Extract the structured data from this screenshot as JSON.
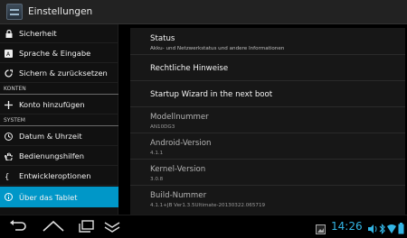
{
  "actionbar": {
    "title": "Einstellungen",
    "icon": "settings-app-icon"
  },
  "sidebar": {
    "items": [
      {
        "label": "Sicherheit",
        "icon": "lock-icon"
      },
      {
        "label": "Sprache & Eingabe",
        "icon": "language-icon"
      },
      {
        "label": "Sichern & zurücksetzen",
        "icon": "backup-icon"
      },
      {
        "label": "Konto hinzufügen",
        "icon": "plus-icon"
      },
      {
        "label": "Datum & Uhrzeit",
        "icon": "clock-icon"
      },
      {
        "label": "Bedienungshilfen",
        "icon": "hand-icon"
      },
      {
        "label": "Entwickleroptionen",
        "icon": "braces-icon"
      },
      {
        "label": "Über das Tablet",
        "icon": "info-icon"
      }
    ],
    "headers": {
      "konten": "KONTEN",
      "system": "SYSTEM"
    },
    "active_index": 7
  },
  "content": {
    "status": {
      "title": "Status",
      "subtitle": "Akku- und Netzwerkstatus und andere Informationen"
    },
    "legal": {
      "title": "Rechtliche Hinweise"
    },
    "wizard": {
      "title": "Startup Wizard in the next boot"
    },
    "model": {
      "title": "Modellnummer",
      "value": "AN10DG3"
    },
    "android": {
      "title": "Android-Version",
      "value": "4.1.1"
    },
    "kernel": {
      "title": "Kernel-Version",
      "value": "3.0.8"
    },
    "build": {
      "title": "Build-Nummer",
      "value": "4.1.1+JB Ver1.3.5Ultimate-20130322.065719"
    }
  },
  "statusbar": {
    "time": "14:26",
    "accent_color": "#33b5e5",
    "icons": [
      "gallery-icon",
      "volume-icon",
      "bluetooth-icon",
      "wifi-icon",
      "battery-icon"
    ]
  },
  "navbar": {
    "buttons": [
      "back-button",
      "home-button",
      "recents-button",
      "hide-button"
    ]
  }
}
